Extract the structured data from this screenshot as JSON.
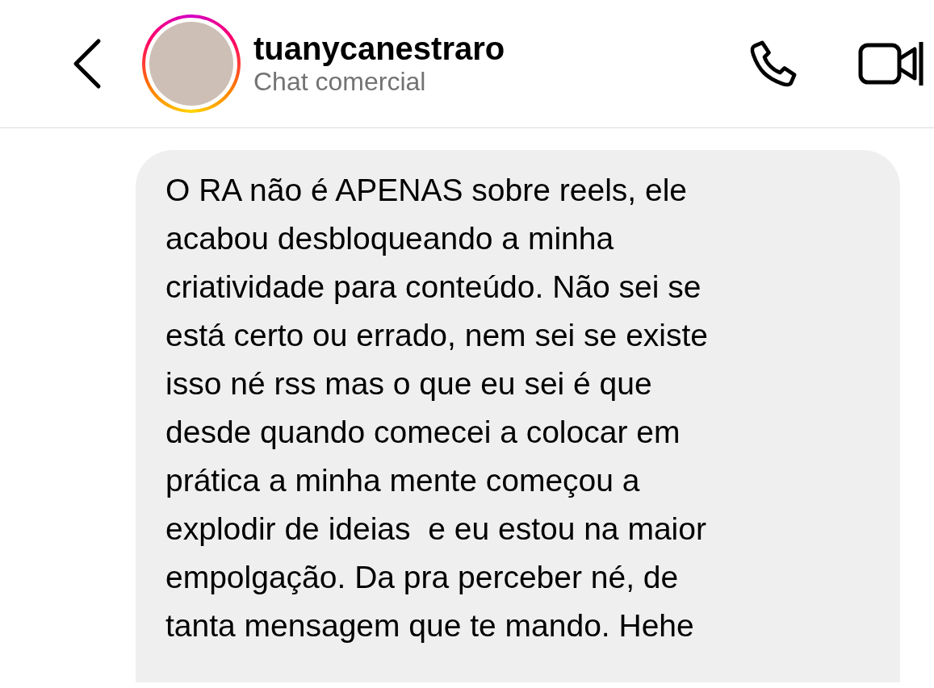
{
  "header": {
    "username": "tuanycanestraro",
    "subtitle": "Chat comercial",
    "has_story": true
  },
  "messages": [
    {
      "text": "O RA não é APENAS sobre reels, ele\nacabou desbloqueando a minha\ncriatividade para conteúdo. Não sei se\nestá certo ou errado, nem sei se existe\nisso né rss mas o que eu sei é que\ndesde quando comecei a colocar em\nprática a minha mente começou a\nexplodir de ideias  e eu estou na maior\nempolgação. Da pra perceber né, de\ntanta mensagem que te mando. Hehe"
    }
  ]
}
